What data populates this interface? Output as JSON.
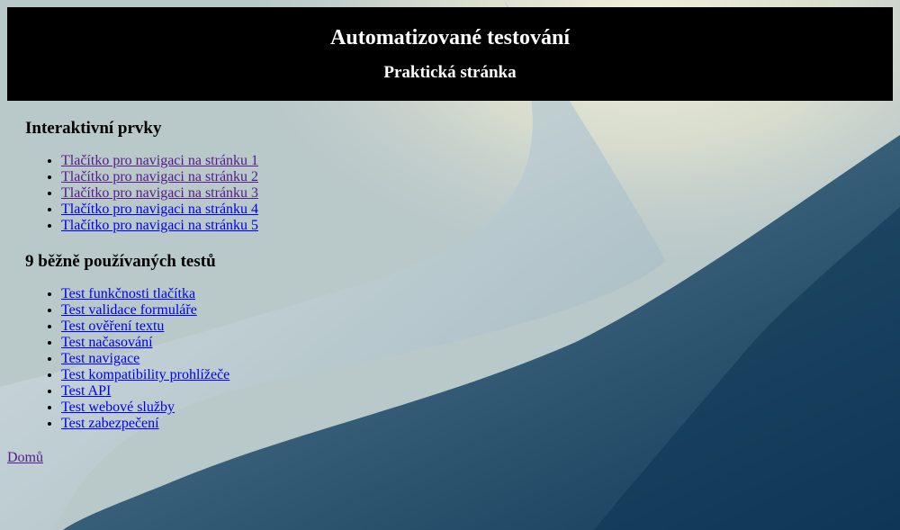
{
  "header": {
    "title": "Automatizované testování",
    "subtitle": "Praktická stránka"
  },
  "interactive": {
    "heading": "Interaktivní prvky",
    "items": [
      {
        "label": "Tlačítko pro navigaci na stránku 1",
        "visited": true
      },
      {
        "label": "Tlačítko pro navigaci na stránku 2",
        "visited": true
      },
      {
        "label": "Tlačítko pro navigaci na stránku 3",
        "visited": true
      },
      {
        "label": "Tlačítko pro navigaci na stránku 4",
        "visited": false
      },
      {
        "label": "Tlačítko pro navigaci na stránku 5",
        "visited": false
      }
    ]
  },
  "tests": {
    "heading": "9 běžně používaných testů",
    "items": [
      {
        "label": "Test funkčnosti tlačítka"
      },
      {
        "label": "Test validace formuláře"
      },
      {
        "label": "Test ověření textu"
      },
      {
        "label": "Test načasování"
      },
      {
        "label": "Test navigace"
      },
      {
        "label": "Test kompatibility prohlížeče"
      },
      {
        "label": "Test API"
      },
      {
        "label": "Test webové služby"
      },
      {
        "label": "Test zabezpečení"
      }
    ]
  },
  "home_link": "Domů",
  "colors": {
    "link": "#0000ee",
    "visited_link": "#551a8b",
    "header_bg": "#000000"
  }
}
